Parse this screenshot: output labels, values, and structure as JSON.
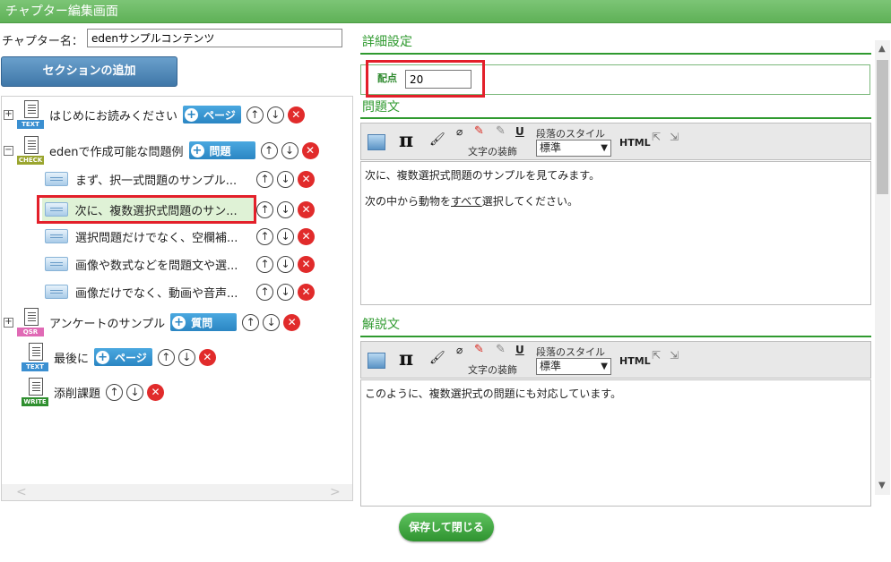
{
  "window": {
    "title": "チャプター編集画面"
  },
  "chapter": {
    "label": "チャプター名：",
    "value": "edenサンプルコンテンツ"
  },
  "add_section_label": "セクションの追加",
  "tree": {
    "items": [
      {
        "label": "はじめにお読みください",
        "icon_tag": "TEXT",
        "badge": "ページ"
      },
      {
        "label": "edenで作成可能な問題例",
        "icon_tag": "CHECK",
        "badge": "問題"
      },
      {
        "label": "まず、択一式問題のサンプル..."
      },
      {
        "label": "次に、複数選択式問題のサン..."
      },
      {
        "label": "選択問題だけでなく、空欄補..."
      },
      {
        "label": "画像や数式などを問題文や選..."
      },
      {
        "label": "画像だけでなく、動画や音声..."
      },
      {
        "label": "アンケートのサンプル",
        "icon_tag": "QSR",
        "badge": "質問"
      },
      {
        "label": "最後に",
        "icon_tag": "TEXT",
        "badge": "ページ"
      },
      {
        "label": "添削課題",
        "icon_tag": "WRITE"
      }
    ]
  },
  "detail": {
    "title": "詳細設定",
    "score_label": "配点",
    "score_value": "20"
  },
  "question": {
    "title": "問題文",
    "toolbar": {
      "deco_label": "文字の装飾",
      "style_label": "段落のスタイル",
      "style_value": "標準",
      "html": "HTML",
      "u": "U"
    },
    "lines": [
      "次に、複数選択式問題のサンプルを見てみます。",
      "次の中から動物を",
      "すべて",
      "選択してください。"
    ]
  },
  "explanation": {
    "title": "解説文",
    "toolbar": {
      "deco_label": "文字の装飾",
      "style_label": "段落のスタイル",
      "style_value": "標準",
      "html": "HTML",
      "u": "U"
    },
    "text": "このように、複数選択式の問題にも対応しています。"
  },
  "save_label": "保存して閉じる",
  "colors": {
    "accent": "#2f9a2f",
    "highlight": "#e3202a",
    "selected": "#dff2d6"
  }
}
